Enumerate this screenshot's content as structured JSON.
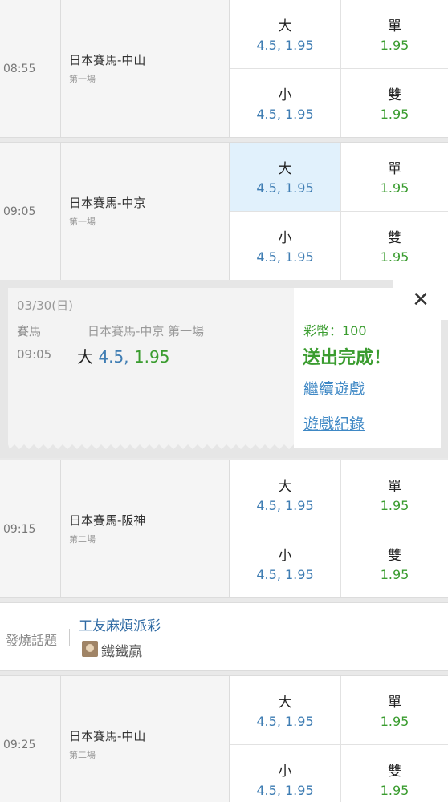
{
  "matches": [
    {
      "time": "08:55",
      "name": "日本賽馬-中山",
      "race": "第一場",
      "big": "大",
      "small": "小",
      "odd": "單",
      "even": "雙",
      "big_val": "4.5, 1.95",
      "small_val": "4.5, 1.95",
      "odd_val": "1.95",
      "even_val": "1.95"
    },
    {
      "time": "09:05",
      "name": "日本賽馬-中京",
      "race": "第一場",
      "big": "大",
      "small": "小",
      "odd": "單",
      "even": "雙",
      "big_val": "4.5, 1.95",
      "small_val": "4.5, 1.95",
      "odd_val": "1.95",
      "even_val": "1.95"
    },
    {
      "time": "09:15",
      "name": "日本賽馬-阪神",
      "race": "第二場",
      "big": "大",
      "small": "小",
      "odd": "單",
      "even": "雙",
      "big_val": "4.5, 1.95",
      "small_val": "4.5, 1.95",
      "odd_val": "1.95",
      "even_val": "1.95"
    },
    {
      "time": "09:25",
      "name": "日本賽馬-中山",
      "race": "第二場",
      "big": "大",
      "small": "小",
      "odd": "單",
      "even": "雙",
      "big_val": "4.5, 1.95",
      "small_val": "4.5, 1.95",
      "odd_val": "1.95",
      "even_val": "1.95"
    }
  ],
  "popup": {
    "date": "03/30(日)",
    "category": "賽馬",
    "time": "09:05",
    "race": "日本賽馬-中京 第一場",
    "pick_label": "大",
    "pick_line": "4.5,",
    "pick_odds": "1.95",
    "coins": "彩幣：100",
    "status": "送出完成！",
    "continue_link": "繼續遊戲",
    "history_link": "遊戲紀錄",
    "close": "✕"
  },
  "topic": {
    "heading": "發燒話題",
    "title": "工友麻煩派彩",
    "user": "鐵鐵贏"
  },
  "colors": {
    "blue": "#3f7db3",
    "green": "#3a9c2f",
    "selected_bg": "#e1f1fc"
  }
}
